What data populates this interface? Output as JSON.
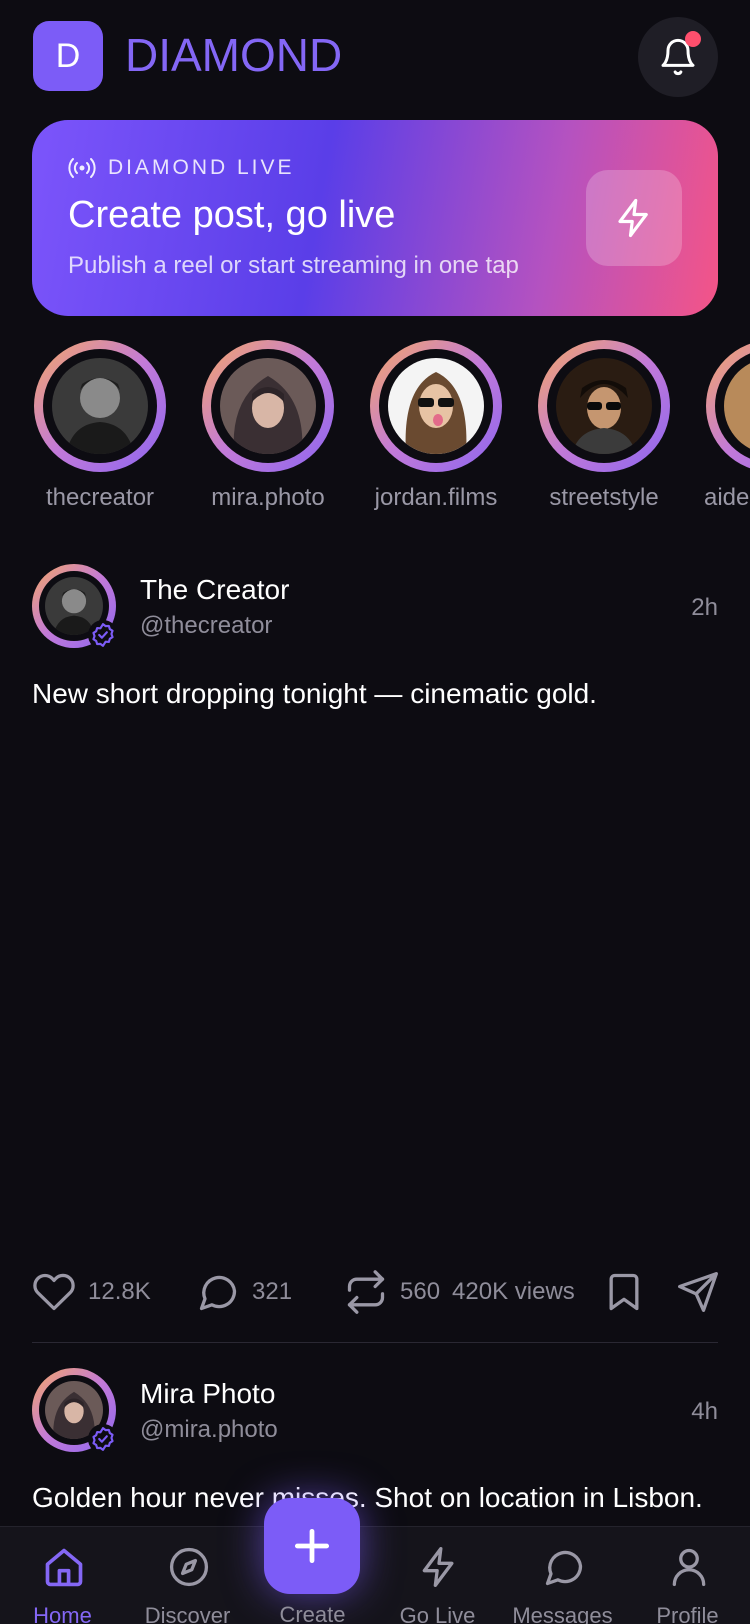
{
  "header": {
    "logo_letter": "D",
    "brand": "DIAMOND",
    "notification_dot": true
  },
  "banner": {
    "eyebrow": "DIAMOND LIVE",
    "title": "Create post, go live",
    "subtitle": "Publish a reel or start streaming in one tap",
    "gradient": [
      "#7c55fb",
      "#5a3ee8",
      "#b552c0",
      "#f45487"
    ]
  },
  "stories": [
    {
      "username": "thecreator"
    },
    {
      "username": "mira.photo"
    },
    {
      "username": "jordan.films"
    },
    {
      "username": "streetstyle"
    },
    {
      "username": "aide"
    }
  ],
  "posts": [
    {
      "name": "The Creator",
      "handle": "@thecreator",
      "time": "2h",
      "text": "New short dropping tonight — cinematic gold.",
      "likes": "12.8K",
      "comments": "321",
      "reposts": "560",
      "views": "420K views"
    },
    {
      "name": "Mira Photo",
      "handle": "@mira.photo",
      "time": "4h",
      "text": "Golden hour never misses. Shot on location in Lisbon."
    }
  ],
  "nav": {
    "home": "Home",
    "discover": "Discover",
    "create": "Create",
    "golive": "Go Live",
    "messages": "Messages",
    "profile": "Profile",
    "active": "home"
  },
  "colors": {
    "accent": "#7c5cf7",
    "background": "#0d0c12",
    "muted": "#8f8d9a",
    "alert": "#ff4f6d"
  }
}
